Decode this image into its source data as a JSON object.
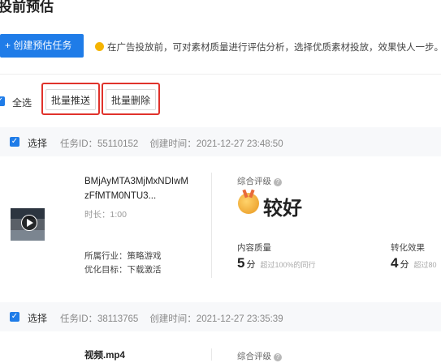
{
  "page": {
    "title": "投前预估"
  },
  "toolbar": {
    "create_label": "+ 创建预估任务",
    "tip_text": "在广告投放前，可对素材质量进行评估分析，选择优质素材投放，效果快人一步。"
  },
  "bulk": {
    "select_all_label": "全选",
    "push_label": "批量推送",
    "delete_label": "批量删除"
  },
  "colors": {
    "accent": "#1f7ce8",
    "highlight_box": "#e0322b"
  },
  "tasks": [
    {
      "select_label": "选择",
      "task_id": "任务ID：55110152",
      "created": "创建时间：2021-12-27 23:48:50",
      "file_name": "BMjAyMTA3MjMxNDIwMzFfMTM0NTU3...",
      "duration": "时长：1:00",
      "industry": "所属行业：策略游戏",
      "goal": "优化目标：下载激活",
      "overall_label": "综合评级",
      "overall_value": "较好",
      "content_quality_label": "内容质量",
      "content_quality_score": "5",
      "score_unit": "分",
      "content_quality_note": "超过100%的同行",
      "conversion_label": "转化效果",
      "conversion_score": "4",
      "conversion_note": "超过80"
    },
    {
      "select_label": "选择",
      "task_id": "任务ID：38113765",
      "created": "创建时间：2021-12-27 23:35:39",
      "file_name": "视频.mp4",
      "overall_label": "综合评级"
    }
  ]
}
